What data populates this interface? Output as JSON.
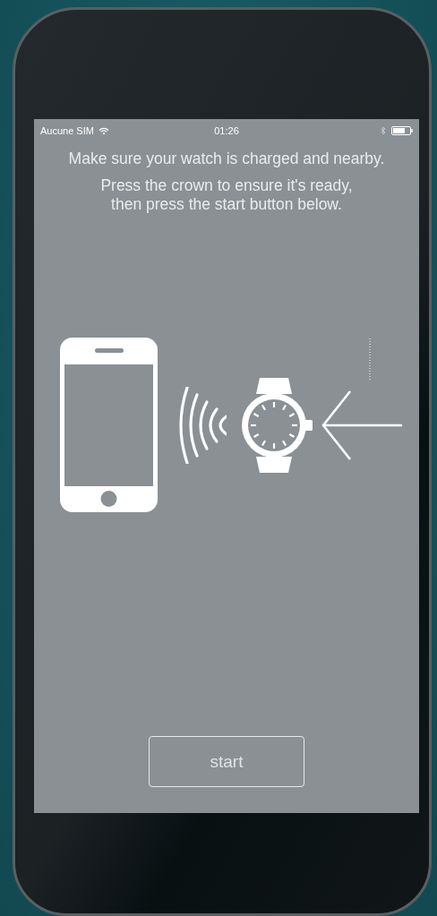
{
  "status_bar": {
    "carrier": "Aucune SIM",
    "time": "01:26"
  },
  "instructions": [
    "Make sure your watch is charged and nearby.",
    "Press the crown to ensure it's ready, then press the start button below."
  ],
  "start_button": {
    "label": "start"
  }
}
